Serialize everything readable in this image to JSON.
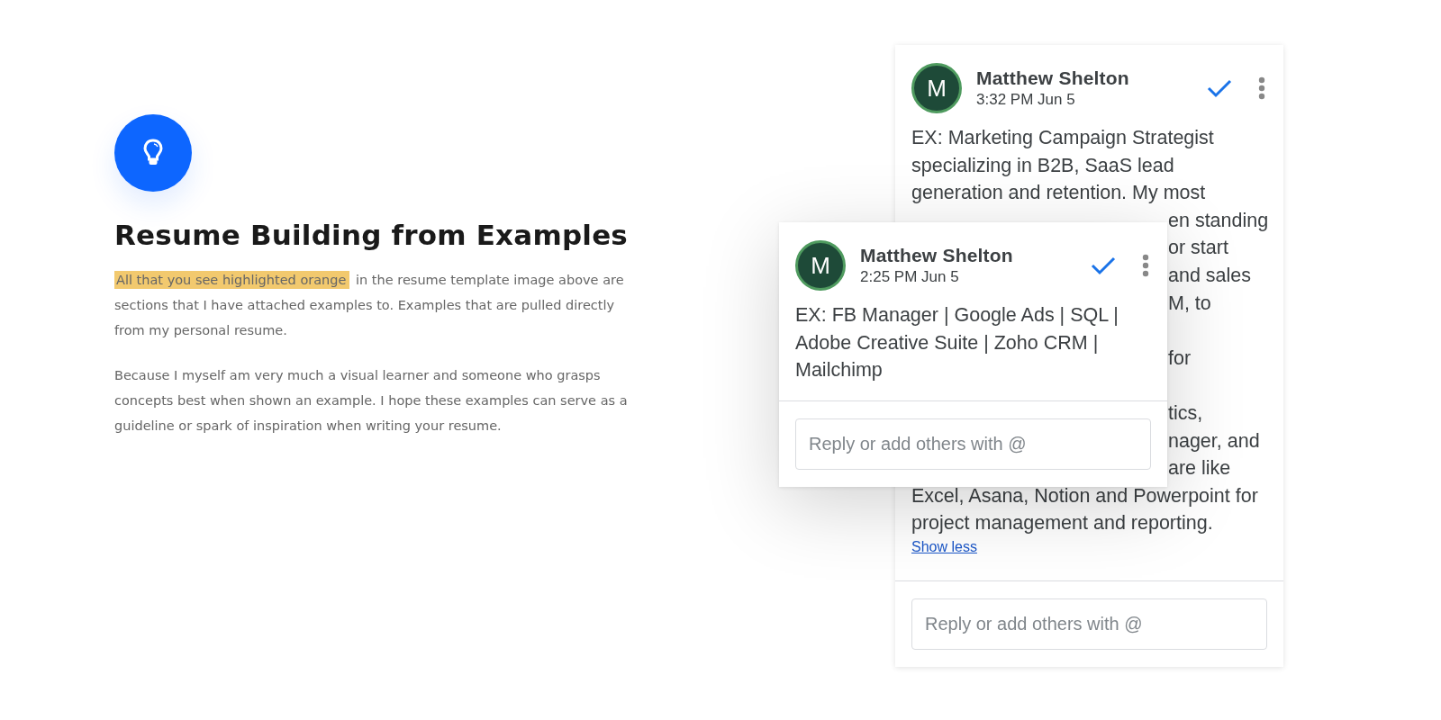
{
  "intro": {
    "title": "Resume Building from Examples",
    "paragraphs": [
      {
        "highlight": "All that you see highlighted orange",
        "text": "in the resume template image above are sections that I have attached examples to. Examples that are pulled directly from my personal resume."
      },
      {
        "text": "Because I myself am very much a visual learner and someone who grasps concepts best when shown an example. I hope these examples can serve as a guideline or spark of inspiration when writing your resume."
      }
    ]
  },
  "back_comment": {
    "avatar": "M",
    "author": "Matthew Shelton",
    "time": "3:32 PM Jun 5",
    "resolved": true,
    "lines_top": [
      "EX: Marketing Campaign Strategist",
      "specializing in B2B, SaaS lead",
      "generation and retention. My most"
    ],
    "fragment_groups": [
      [
        "en standing",
        "or start",
        "and sales",
        "M, to"
      ],
      [
        "for"
      ],
      [
        "tics,",
        "nager, and",
        "are like"
      ]
    ],
    "lines_bottom": [
      "Excel, Asana, Notion and Powerpoint for",
      "project management and reporting."
    ],
    "link": "Show less",
    "reply_placeholder": "Reply or add others with @"
  },
  "front_comment": {
    "avatar": "M",
    "author": "Matthew Shelton",
    "time": "2:25 PM Jun 5",
    "resolved": true,
    "body": "EX: FB Manager | Google Ads | SQL | Adobe Creative Suite | Zoho CRM | Mailchimp",
    "reply_placeholder": "Reply or add others with @"
  }
}
